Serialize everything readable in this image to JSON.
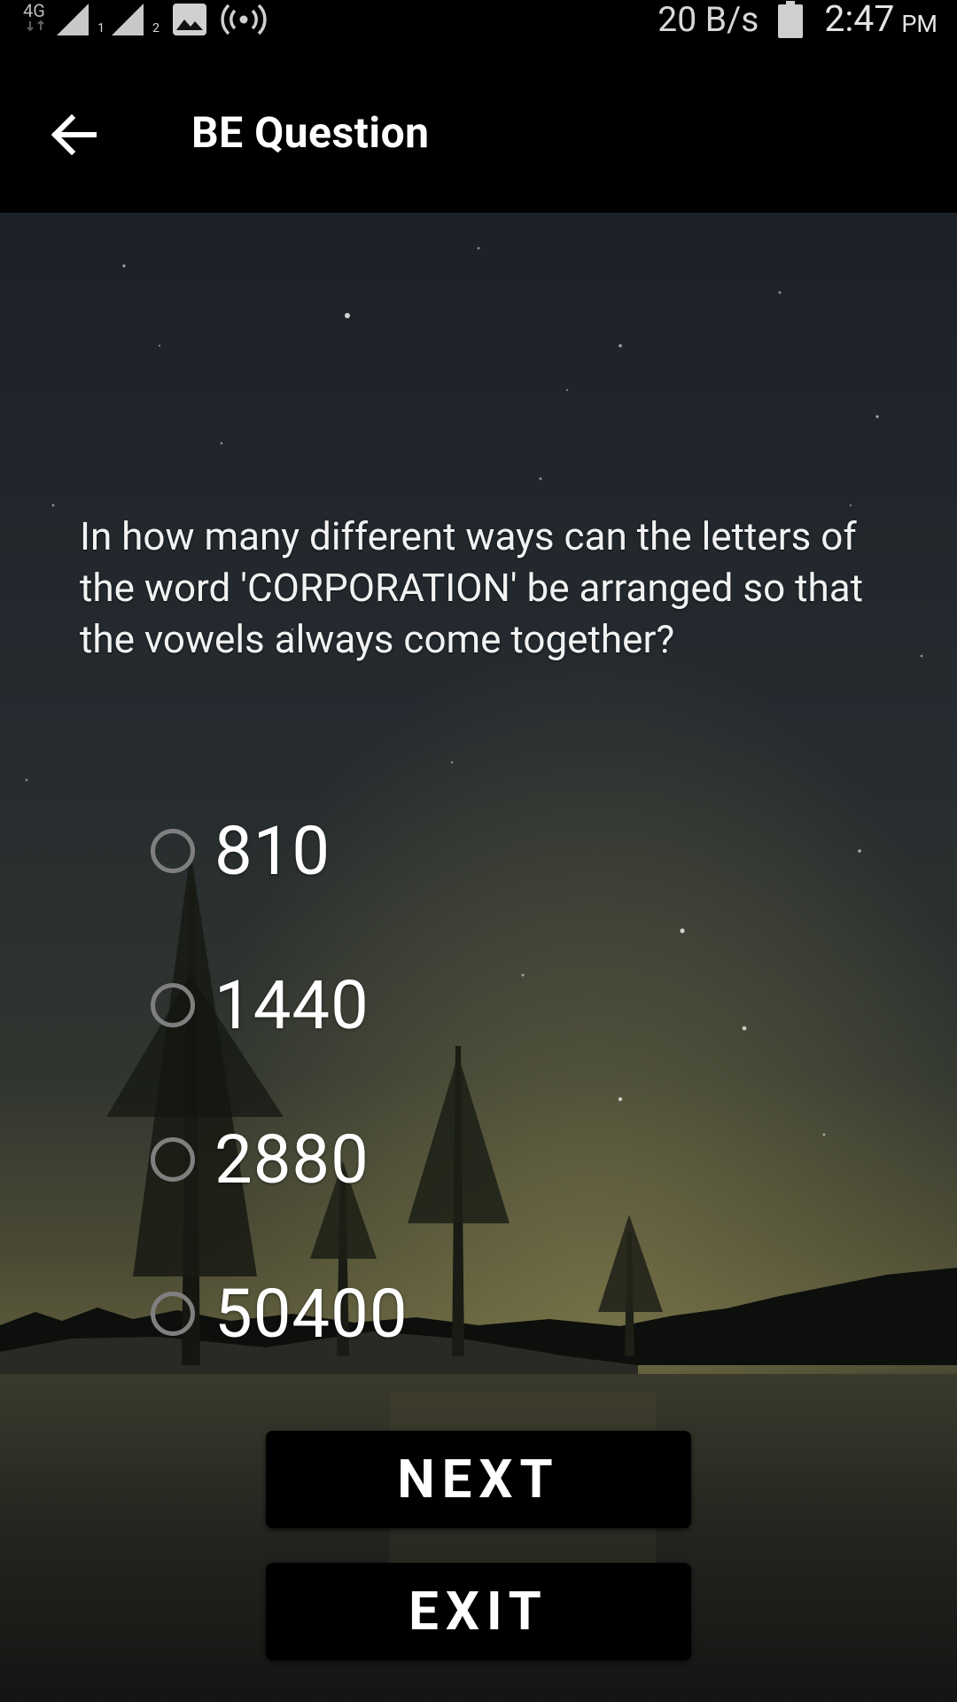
{
  "status_bar": {
    "network_type": "4G",
    "sim1_label": "1",
    "sim2_label": "2",
    "speed": "20 B/s",
    "time": "2:47",
    "ampm": "PM",
    "icons": [
      "network-arrows-icon",
      "signal-sim1-icon",
      "signal-sim2-icon",
      "gallery-icon",
      "hotspot-icon",
      "battery-icon"
    ]
  },
  "app_bar": {
    "back_icon": "arrow-back-icon",
    "title": "BE Question"
  },
  "question": {
    "text": "In how many different ways can the letters of the word 'CORPORATION' be arranged so that the vowels always come together?"
  },
  "options": [
    {
      "label": "810",
      "selected": false
    },
    {
      "label": "1440",
      "selected": false
    },
    {
      "label": "2880",
      "selected": false
    },
    {
      "label": "50400",
      "selected": false
    }
  ],
  "buttons": {
    "next_label": "NEXT",
    "exit_label": "EXIT"
  },
  "colors": {
    "bar_background": "#000000",
    "text": "#ffffff",
    "radio_border": "#7f7f7f"
  }
}
